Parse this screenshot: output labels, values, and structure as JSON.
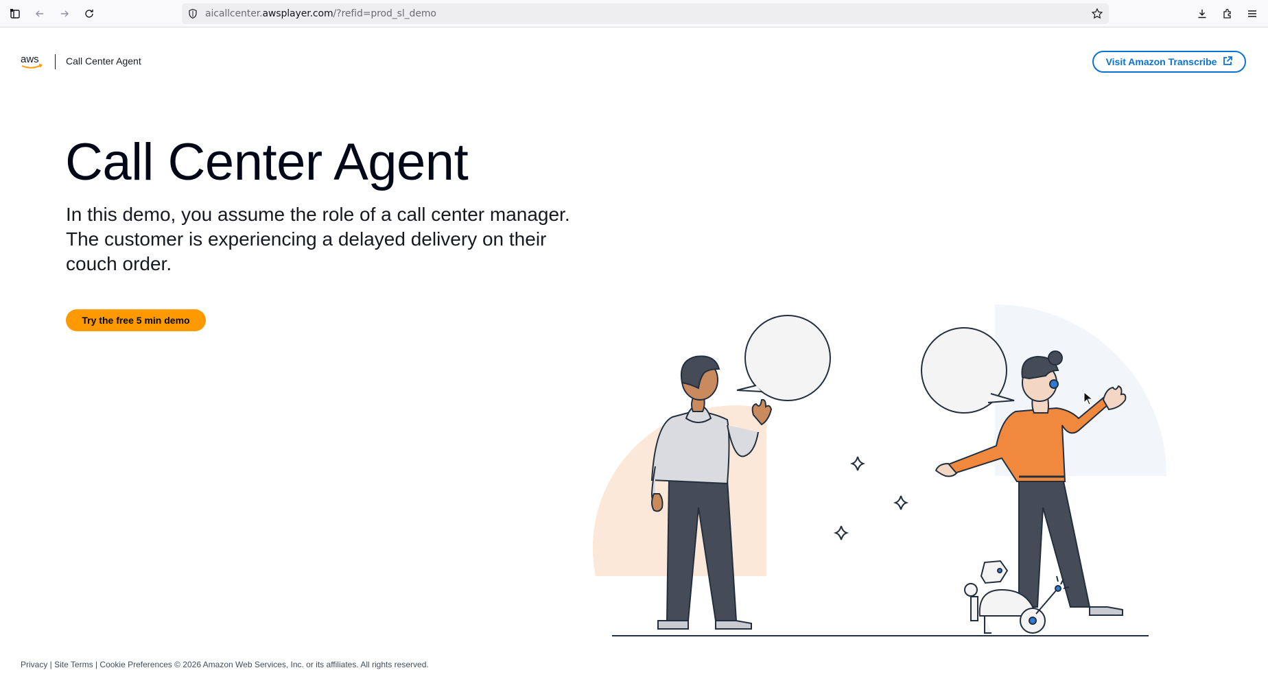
{
  "browser": {
    "url_prefix": "aicallcenter.",
    "url_domain": "awsplayer.com",
    "url_path": "/?refid=prod_sl_demo"
  },
  "header": {
    "logo_text": "aws",
    "title": "Call Center Agent",
    "visit_button": "Visit Amazon Transcribe"
  },
  "hero": {
    "title": "Call Center Agent",
    "description": "In this demo, you assume the role of a call center manager. The customer is experiencing a delayed delivery on their couch order.",
    "cta_button": "Try the free 5 min demo"
  },
  "footer": {
    "privacy": "Privacy",
    "sep1": " | ",
    "site_terms": "Site Terms",
    "sep2": " | ",
    "cookies": "Cookie Preferences",
    "copyright": " © 2026 Amazon Web Services, Inc. or its affiliates. All rights reserved."
  },
  "colors": {
    "accent_orange": "#ff9900",
    "link_blue": "#0972d3",
    "shirt_orange": "#f0883e",
    "peach_bg": "#fce8d8"
  }
}
